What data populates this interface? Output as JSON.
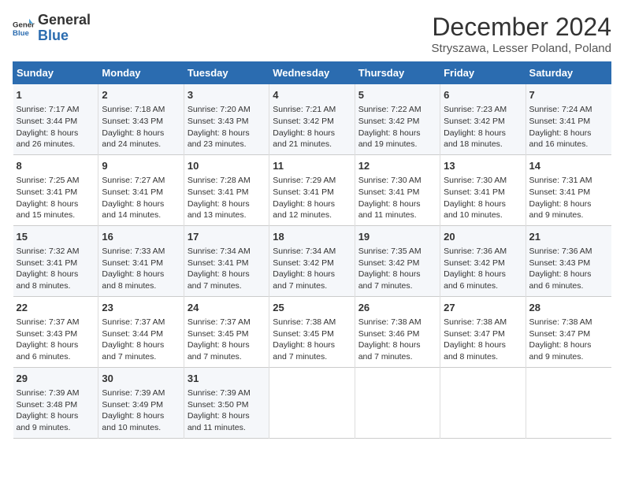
{
  "logo": {
    "line1": "General",
    "line2": "Blue"
  },
  "title": "December 2024",
  "subtitle": "Stryszawa, Lesser Poland, Poland",
  "days_header": [
    "Sunday",
    "Monday",
    "Tuesday",
    "Wednesday",
    "Thursday",
    "Friday",
    "Saturday"
  ],
  "weeks": [
    [
      {
        "day": "1",
        "lines": [
          "Sunrise: 7:17 AM",
          "Sunset: 3:44 PM",
          "Daylight: 8 hours",
          "and 26 minutes."
        ]
      },
      {
        "day": "2",
        "lines": [
          "Sunrise: 7:18 AM",
          "Sunset: 3:43 PM",
          "Daylight: 8 hours",
          "and 24 minutes."
        ]
      },
      {
        "day": "3",
        "lines": [
          "Sunrise: 7:20 AM",
          "Sunset: 3:43 PM",
          "Daylight: 8 hours",
          "and 23 minutes."
        ]
      },
      {
        "day": "4",
        "lines": [
          "Sunrise: 7:21 AM",
          "Sunset: 3:42 PM",
          "Daylight: 8 hours",
          "and 21 minutes."
        ]
      },
      {
        "day": "5",
        "lines": [
          "Sunrise: 7:22 AM",
          "Sunset: 3:42 PM",
          "Daylight: 8 hours",
          "and 19 minutes."
        ]
      },
      {
        "day": "6",
        "lines": [
          "Sunrise: 7:23 AM",
          "Sunset: 3:42 PM",
          "Daylight: 8 hours",
          "and 18 minutes."
        ]
      },
      {
        "day": "7",
        "lines": [
          "Sunrise: 7:24 AM",
          "Sunset: 3:41 PM",
          "Daylight: 8 hours",
          "and 16 minutes."
        ]
      }
    ],
    [
      {
        "day": "8",
        "lines": [
          "Sunrise: 7:25 AM",
          "Sunset: 3:41 PM",
          "Daylight: 8 hours",
          "and 15 minutes."
        ]
      },
      {
        "day": "9",
        "lines": [
          "Sunrise: 7:27 AM",
          "Sunset: 3:41 PM",
          "Daylight: 8 hours",
          "and 14 minutes."
        ]
      },
      {
        "day": "10",
        "lines": [
          "Sunrise: 7:28 AM",
          "Sunset: 3:41 PM",
          "Daylight: 8 hours",
          "and 13 minutes."
        ]
      },
      {
        "day": "11",
        "lines": [
          "Sunrise: 7:29 AM",
          "Sunset: 3:41 PM",
          "Daylight: 8 hours",
          "and 12 minutes."
        ]
      },
      {
        "day": "12",
        "lines": [
          "Sunrise: 7:30 AM",
          "Sunset: 3:41 PM",
          "Daylight: 8 hours",
          "and 11 minutes."
        ]
      },
      {
        "day": "13",
        "lines": [
          "Sunrise: 7:30 AM",
          "Sunset: 3:41 PM",
          "Daylight: 8 hours",
          "and 10 minutes."
        ]
      },
      {
        "day": "14",
        "lines": [
          "Sunrise: 7:31 AM",
          "Sunset: 3:41 PM",
          "Daylight: 8 hours",
          "and 9 minutes."
        ]
      }
    ],
    [
      {
        "day": "15",
        "lines": [
          "Sunrise: 7:32 AM",
          "Sunset: 3:41 PM",
          "Daylight: 8 hours",
          "and 8 minutes."
        ]
      },
      {
        "day": "16",
        "lines": [
          "Sunrise: 7:33 AM",
          "Sunset: 3:41 PM",
          "Daylight: 8 hours",
          "and 8 minutes."
        ]
      },
      {
        "day": "17",
        "lines": [
          "Sunrise: 7:34 AM",
          "Sunset: 3:41 PM",
          "Daylight: 8 hours",
          "and 7 minutes."
        ]
      },
      {
        "day": "18",
        "lines": [
          "Sunrise: 7:34 AM",
          "Sunset: 3:42 PM",
          "Daylight: 8 hours",
          "and 7 minutes."
        ]
      },
      {
        "day": "19",
        "lines": [
          "Sunrise: 7:35 AM",
          "Sunset: 3:42 PM",
          "Daylight: 8 hours",
          "and 7 minutes."
        ]
      },
      {
        "day": "20",
        "lines": [
          "Sunrise: 7:36 AM",
          "Sunset: 3:42 PM",
          "Daylight: 8 hours",
          "and 6 minutes."
        ]
      },
      {
        "day": "21",
        "lines": [
          "Sunrise: 7:36 AM",
          "Sunset: 3:43 PM",
          "Daylight: 8 hours",
          "and 6 minutes."
        ]
      }
    ],
    [
      {
        "day": "22",
        "lines": [
          "Sunrise: 7:37 AM",
          "Sunset: 3:43 PM",
          "Daylight: 8 hours",
          "and 6 minutes."
        ]
      },
      {
        "day": "23",
        "lines": [
          "Sunrise: 7:37 AM",
          "Sunset: 3:44 PM",
          "Daylight: 8 hours",
          "and 7 minutes."
        ]
      },
      {
        "day": "24",
        "lines": [
          "Sunrise: 7:37 AM",
          "Sunset: 3:45 PM",
          "Daylight: 8 hours",
          "and 7 minutes."
        ]
      },
      {
        "day": "25",
        "lines": [
          "Sunrise: 7:38 AM",
          "Sunset: 3:45 PM",
          "Daylight: 8 hours",
          "and 7 minutes."
        ]
      },
      {
        "day": "26",
        "lines": [
          "Sunrise: 7:38 AM",
          "Sunset: 3:46 PM",
          "Daylight: 8 hours",
          "and 7 minutes."
        ]
      },
      {
        "day": "27",
        "lines": [
          "Sunrise: 7:38 AM",
          "Sunset: 3:47 PM",
          "Daylight: 8 hours",
          "and 8 minutes."
        ]
      },
      {
        "day": "28",
        "lines": [
          "Sunrise: 7:38 AM",
          "Sunset: 3:47 PM",
          "Daylight: 8 hours",
          "and 9 minutes."
        ]
      }
    ],
    [
      {
        "day": "29",
        "lines": [
          "Sunrise: 7:39 AM",
          "Sunset: 3:48 PM",
          "Daylight: 8 hours",
          "and 9 minutes."
        ]
      },
      {
        "day": "30",
        "lines": [
          "Sunrise: 7:39 AM",
          "Sunset: 3:49 PM",
          "Daylight: 8 hours",
          "and 10 minutes."
        ]
      },
      {
        "day": "31",
        "lines": [
          "Sunrise: 7:39 AM",
          "Sunset: 3:50 PM",
          "Daylight: 8 hours",
          "and 11 minutes."
        ]
      },
      null,
      null,
      null,
      null
    ]
  ]
}
